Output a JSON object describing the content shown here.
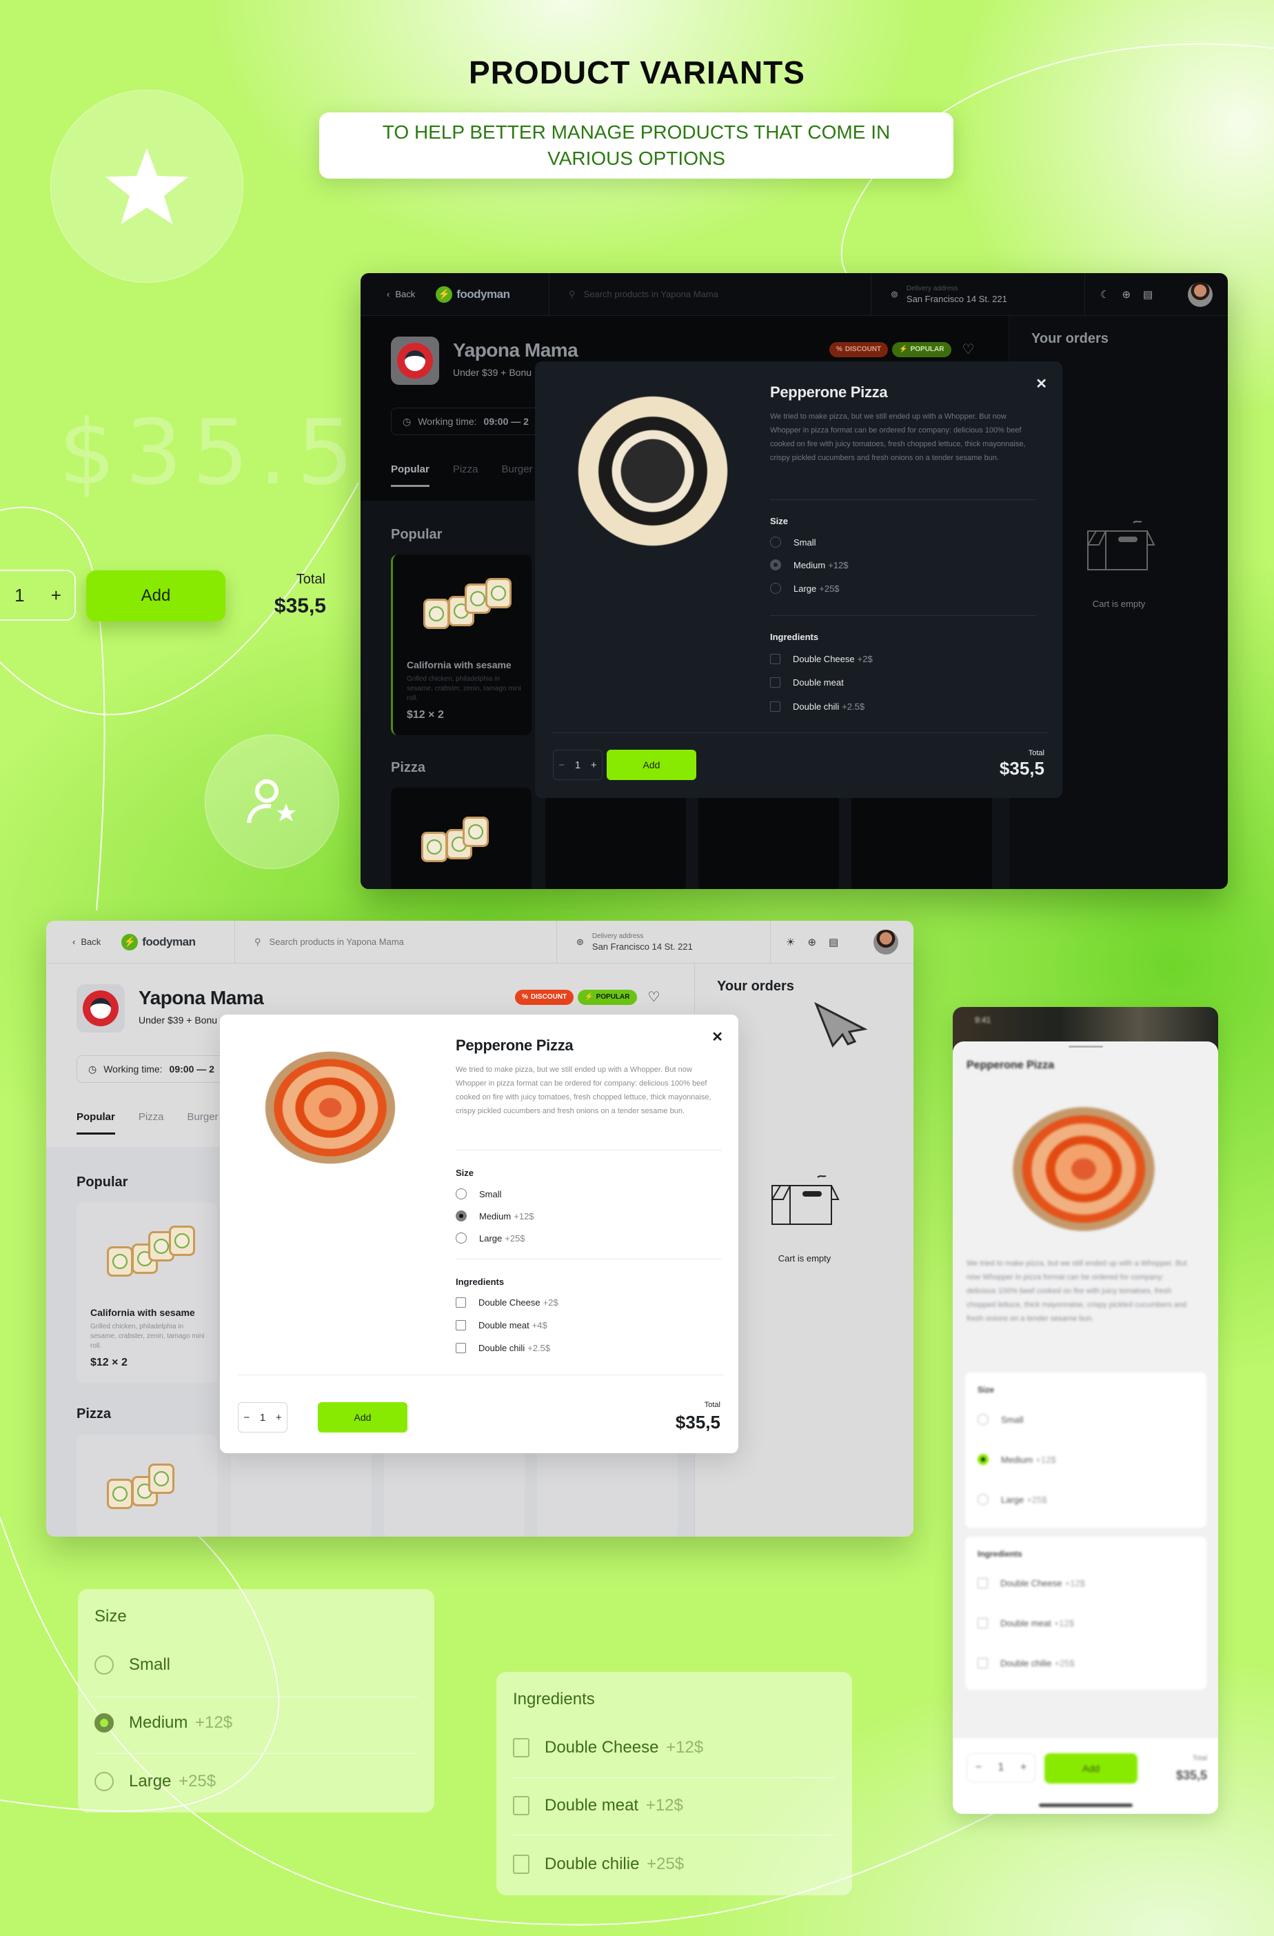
{
  "hero": {
    "title": "PRODUCT VARIANTS",
    "subtitle": "TO HELP BETTER MANAGE PRODUCTS THAT COME IN VARIOUS OPTIONS"
  },
  "floating": {
    "ghost_price": "$35.5",
    "quantity": "1",
    "plus": "+",
    "add_label": "Add",
    "total_label": "Total",
    "total_value": "$35,5"
  },
  "colors": {
    "accent": "#88ea00",
    "discount": "#d8401c",
    "popular": "#6bc414",
    "background": "#bdf76c"
  },
  "app": {
    "back_label": "Back",
    "brand": "foodyman",
    "search_placeholder": "Search products in Yapona Mama",
    "delivery_label": "Delivery address",
    "delivery_address": "San Francisco 14 St. 221",
    "restaurant_name": "Yapona Mama",
    "restaurant_sub": "Under $39 + Bonu",
    "working_label": "Working time:",
    "working_value": "09:00 — 2",
    "badges": {
      "discount": "DISCOUNT",
      "popular": "POPULAR"
    },
    "tabs": [
      "Popular",
      "Pizza",
      "Burger"
    ],
    "sections": {
      "popular": "Popular",
      "pizza": "Pizza"
    },
    "card": {
      "name": "California with sesame",
      "description": "Grilled chicken, philadelphia in sesame, crabster, zenin, tamago mini roll.",
      "price": "$12",
      "times": "×",
      "qty": "2"
    },
    "orders_title": "Your orders",
    "cart_empty": "Cart is empty"
  },
  "modal": {
    "title": "Pepperone Pizza",
    "description": "We tried to make pizza, but we still ended up with a Whopper. But now Whopper in pizza format can be ordered for company: delicious 100% beef cooked on fire with juicy tomatoes, fresh chopped lettuce, thick mayonnaise, crispy pickled cucumbers and fresh onions on a tender sesame bun.",
    "size_label": "Size",
    "sizes": [
      {
        "label": "Small",
        "price": "",
        "selected": false
      },
      {
        "label": "Medium",
        "price": "+12$",
        "selected": true
      },
      {
        "label": "Large",
        "price": "+25$",
        "selected": false
      }
    ],
    "ingredients_label": "Ingredients",
    "ingredients_dark": [
      {
        "label": "Double Cheese",
        "price": "+2$"
      },
      {
        "label": "Double meat",
        "price": ""
      },
      {
        "label": "Double chili",
        "price": "+2.5$"
      }
    ],
    "ingredients_light": [
      {
        "label": "Double Cheese",
        "price": "+2$"
      },
      {
        "label": "Double meat",
        "price": "+4$"
      },
      {
        "label": "Double chili",
        "price": "+2.5$"
      }
    ],
    "minus": "−",
    "quantity": "1",
    "plus": "+",
    "add_label": "Add",
    "total_label": "Total",
    "total_value": "$35,5"
  },
  "phone": {
    "status_time": "9:41",
    "title": "Pepperone Pizza",
    "description": "We tried to make pizza, but we still ended up with a Whopper. But now Whopper in pizza format can be ordered for company: delicious 100% beef cooked on fire with juicy tomatoes, fresh chopped lettuce, thick mayonnaise, crispy pickled cucumbers and fresh onions on a tender sesame bun.",
    "size_label": "Size",
    "sizes": [
      {
        "label": "Small",
        "price": ""
      },
      {
        "label": "Medium",
        "price": "+12$"
      },
      {
        "label": "Large",
        "price": "+25$"
      }
    ],
    "ingredients_label": "Ingredients",
    "ingredients": [
      {
        "label": "Double Cheese",
        "price": "+12$"
      },
      {
        "label": "Double meat",
        "price": "+12$"
      },
      {
        "label": "Double chilie",
        "price": "+25$"
      }
    ],
    "quantity": "1",
    "add_label": "Add",
    "total_label": "Total",
    "total_value": "$35,5"
  },
  "panels": {
    "size": {
      "title": "Size",
      "options": [
        {
          "label": "Small",
          "price": ""
        },
        {
          "label": "Medium",
          "price": "+12$"
        },
        {
          "label": "Large",
          "price": "+25$"
        }
      ]
    },
    "ingredients": {
      "title": "Ingredients",
      "options": [
        {
          "label": "Double Cheese",
          "price": "+12$"
        },
        {
          "label": "Double meat",
          "price": "+12$"
        },
        {
          "label": "Double chilie",
          "price": "+25$"
        }
      ]
    }
  }
}
